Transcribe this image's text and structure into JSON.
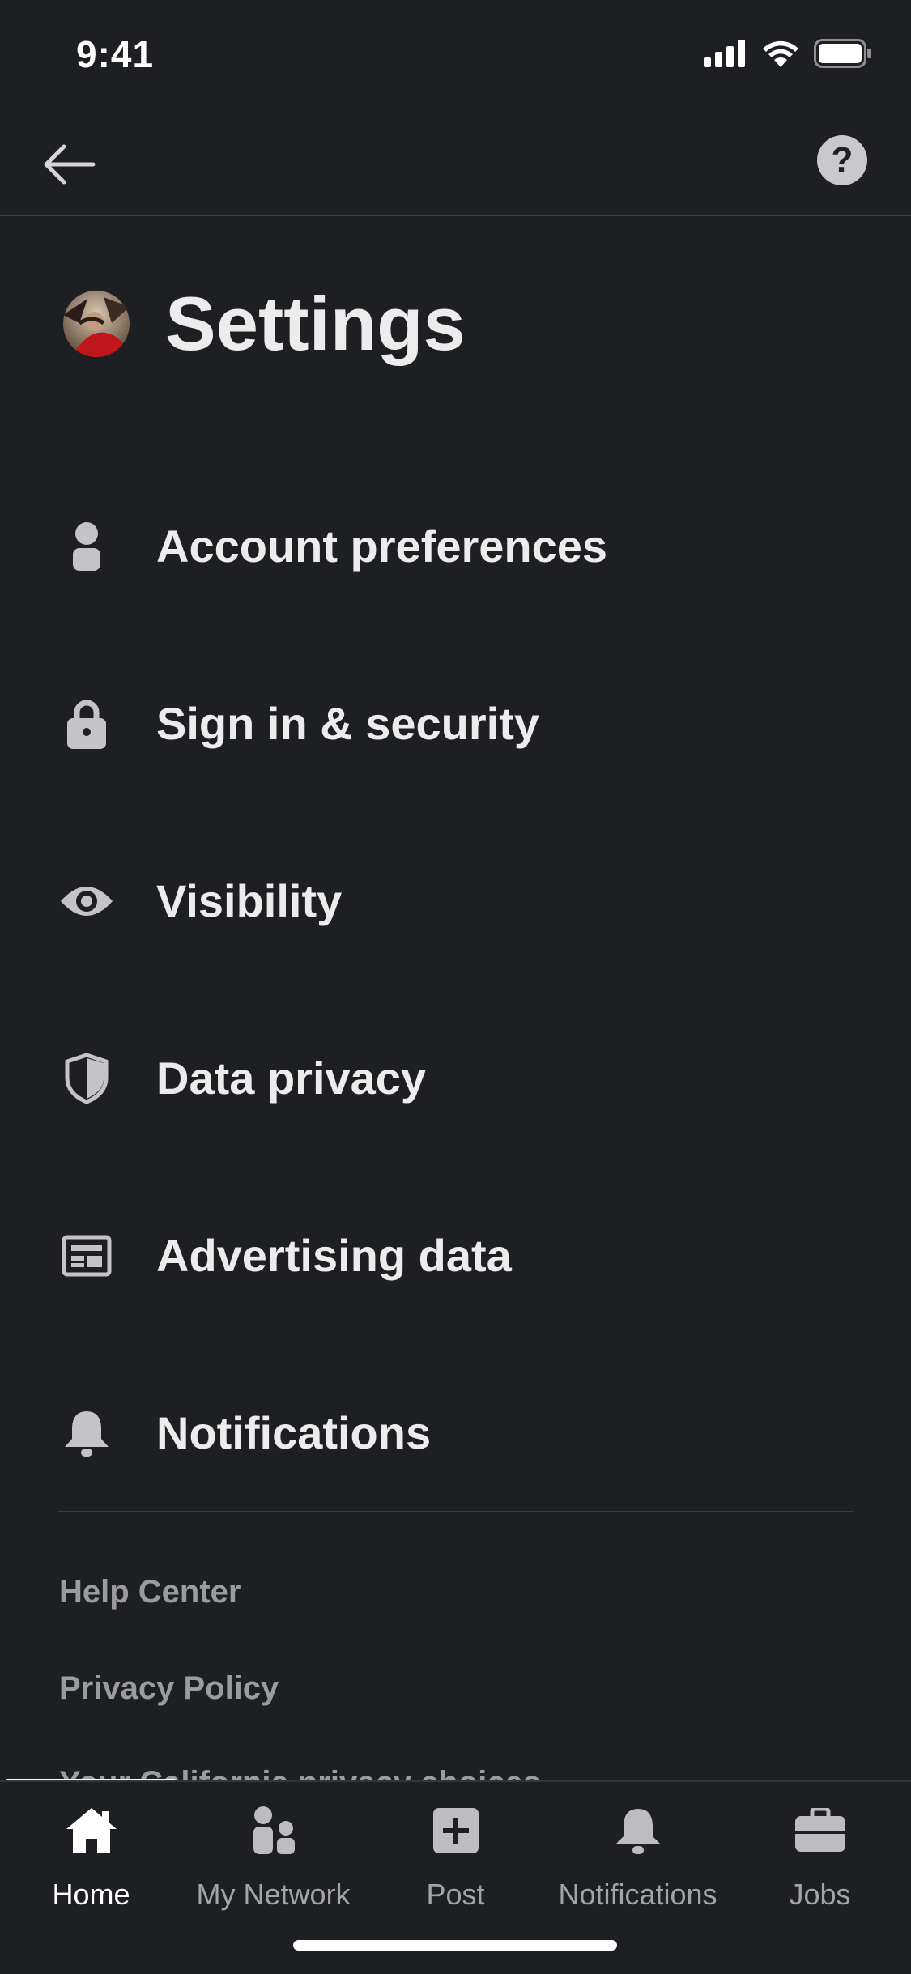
{
  "status_bar": {
    "time": "9:41"
  },
  "header": {
    "help_label": "?"
  },
  "page": {
    "title": "Settings"
  },
  "menu": {
    "items": [
      {
        "label": "Account preferences",
        "icon": "person-icon"
      },
      {
        "label": "Sign in & security",
        "icon": "lock-icon"
      },
      {
        "label": "Visibility",
        "icon": "eye-icon"
      },
      {
        "label": "Data privacy",
        "icon": "shield-icon"
      },
      {
        "label": "Advertising data",
        "icon": "ad-card-icon"
      },
      {
        "label": "Notifications",
        "icon": "bell-icon"
      }
    ]
  },
  "footer_links": {
    "help_center": "Help Center",
    "privacy_policy": "Privacy Policy",
    "partially_hidden": "Your California privacy choices"
  },
  "bottom_nav": {
    "items": [
      {
        "label": "Home",
        "icon": "home-icon",
        "active": true
      },
      {
        "label": "My Network",
        "icon": "network-icon"
      },
      {
        "label": "Post",
        "icon": "post-icon"
      },
      {
        "label": "Notifications",
        "icon": "bell-icon"
      },
      {
        "label": "Jobs",
        "icon": "briefcase-icon"
      }
    ]
  },
  "colors": {
    "background": "#1e1f23",
    "text_primary": "#ececed",
    "text_secondary": "#9b9ca0",
    "divider": "#3a3b40"
  }
}
